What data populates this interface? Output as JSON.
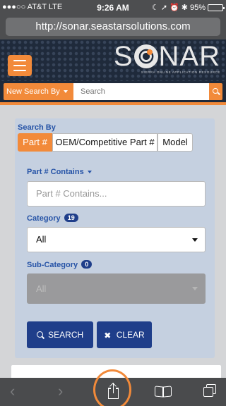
{
  "status": {
    "carrier": "●●●○○ AT&T  LTE",
    "time": "9:26 AM",
    "battery": "95%",
    "battery_level": 0.95
  },
  "browser": {
    "url": "http://sonar.seastarsolutions.com"
  },
  "header": {
    "logo_text": "SONAR",
    "logo_s": "S",
    "logo_nar": "NAR",
    "logo_tagline": "SIERRA ONLINE APPLICATION RESOURCE"
  },
  "search": {
    "new_search_label": "New Search By",
    "placeholder": "Search"
  },
  "form": {
    "search_by_label": "Search By",
    "segments": [
      "Part #",
      "OEM/Competitive Part #",
      "Model"
    ],
    "part_contains_label": "Part # Contains",
    "part_contains_placeholder": "Part # Contains...",
    "category_label": "Category",
    "category_count": "19",
    "category_value": "All",
    "subcategory_label": "Sub-Category",
    "subcategory_count": "0",
    "subcategory_value": "All",
    "search_button": "SEARCH",
    "clear_button": "CLEAR"
  },
  "toolbar": {
    "back": "‹",
    "forward": "›"
  },
  "colors": {
    "accent": "#f28a3a",
    "navy": "#1f3e8a",
    "header_bg": "#1f2a3b"
  }
}
